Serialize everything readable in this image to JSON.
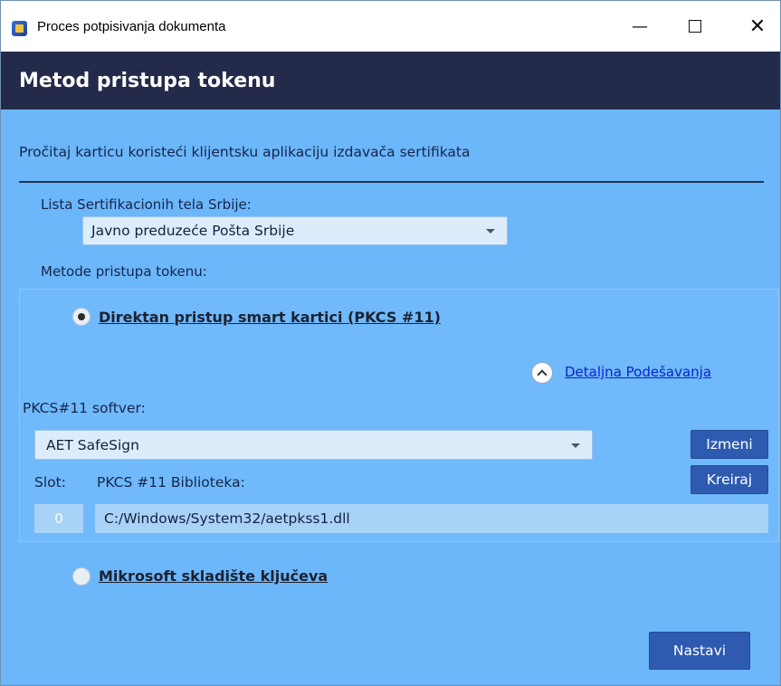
{
  "window": {
    "title": "Proces potpisivanja dokumenta",
    "minimize_label": "—",
    "close_label": "✕"
  },
  "header": {
    "title": "Metod pristupa tokenu"
  },
  "subtitle": "Pročitaj karticu koristeći klijentsku aplikaciju izdavača sertifikata",
  "ca_list": {
    "label": "Lista Sertifikacionih tela Srbije:",
    "selected": "Javno preduzeće Pošta Srbije"
  },
  "methods_label": "Metode pristupa tokenu:",
  "method_direct": {
    "label": "Direktan pristup smart kartici (PKCS #11)",
    "selected": true,
    "details_link": "Detaljna Podešavanja",
    "pkcs_software_label": "PKCS#11 softver:",
    "pkcs_software_selected": "AET SafeSign",
    "edit_button": "Izmeni",
    "create_button": "Kreiraj",
    "slot_label": "Slot:",
    "slot_value": "0",
    "library_label": "PKCS #11 Biblioteka:",
    "library_value": "C:/Windows/System32/aetpkss1.dll"
  },
  "method_ms": {
    "label": "Mikrosoft skladište ključeva",
    "selected": false
  },
  "continue_button": "Nastavi",
  "colors": {
    "header_bg": "#242a49",
    "body_bg": "#6cb6fa",
    "button_bg": "#2e5bb0",
    "link": "#0b24c9"
  }
}
